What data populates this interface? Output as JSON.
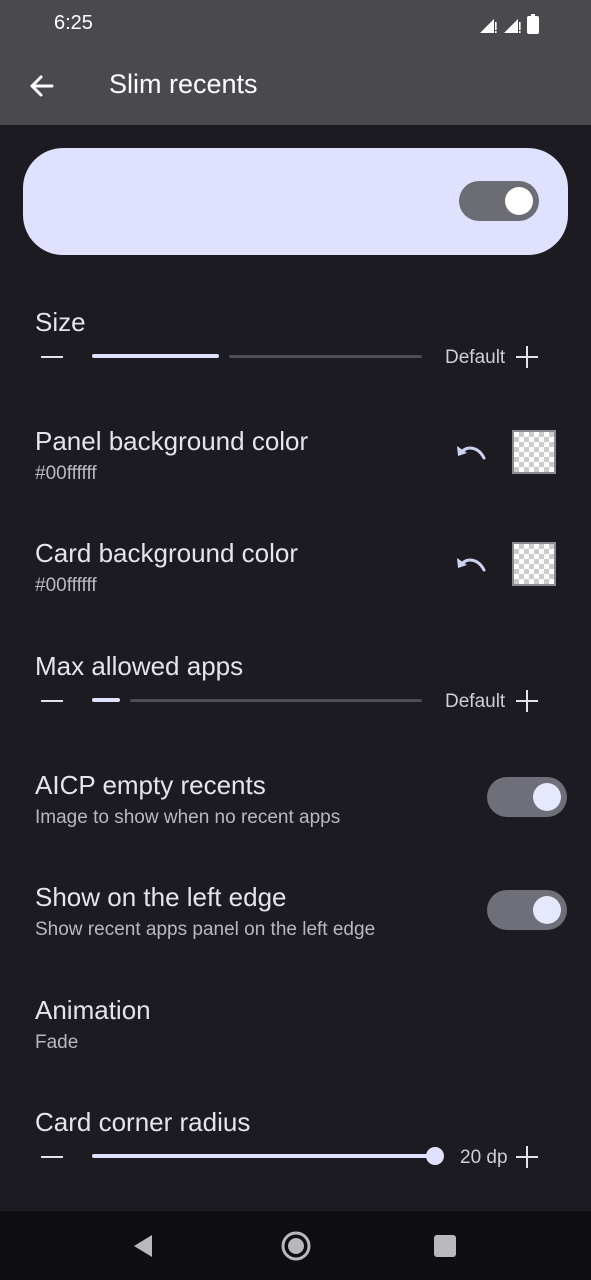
{
  "status_bar": {
    "time": "6:25"
  },
  "app_bar": {
    "title": "Slim recents"
  },
  "master_switch": {
    "enabled": true
  },
  "size": {
    "title": "Size",
    "value_label": "Default",
    "level": 0.38
  },
  "panel_bg": {
    "title": "Panel background color",
    "value": "#00ffffff"
  },
  "card_bg": {
    "title": "Card background color",
    "value": "#00ffffff"
  },
  "max_apps": {
    "title": "Max allowed apps",
    "value_label": "Default",
    "level": 0.08
  },
  "aicp": {
    "title": "AICP empty recents",
    "subtitle": "Image to show when no recent apps",
    "enabled": true
  },
  "left_edge": {
    "title": "Show on the left edge",
    "subtitle": "Show recent apps panel on the left edge",
    "enabled": true
  },
  "animation": {
    "title": "Animation",
    "value": "Fade"
  },
  "corner_radius": {
    "title": "Card corner radius",
    "value_label": "20 dp",
    "level": 1.0
  },
  "colors": {
    "accent": "#dfe1ff",
    "background": "#1b1b21",
    "app_bar": "#4a4a4e"
  }
}
